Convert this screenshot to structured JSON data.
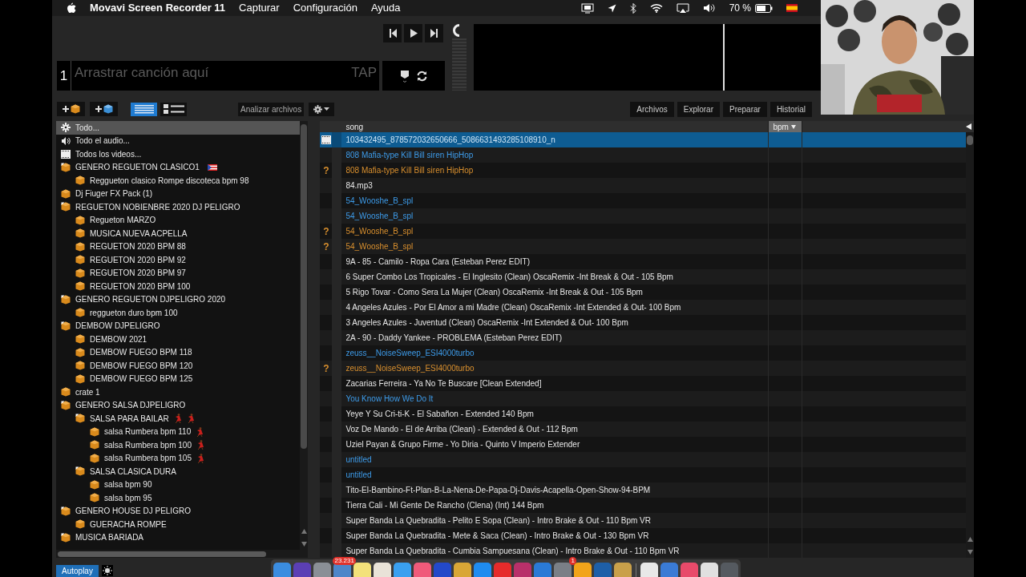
{
  "menu_bar": {
    "app_name": "Movavi Screen Recorder 11",
    "menus": [
      "Capturar",
      "Configuración",
      "Ayuda"
    ],
    "battery_text": "70 %"
  },
  "deck": {
    "number": "1",
    "placeholder": "Arrastrar canción aquí",
    "tap": "TAP"
  },
  "toolbar": {
    "analyze": "Analizar archivos",
    "views": [
      {
        "kind": "list",
        "selected": true
      },
      {
        "kind": "art",
        "selected": false
      }
    ],
    "tabs": [
      {
        "label": "Archivos",
        "selected": false
      },
      {
        "label": "Explorar",
        "selected": false
      },
      {
        "label": "Preparar",
        "selected": false
      },
      {
        "label": "Historial",
        "selected": false
      }
    ]
  },
  "sidebar": {
    "items": [
      {
        "label": "Todo...",
        "kind": "all",
        "selected": true
      },
      {
        "label": "Todo el audio...",
        "kind": "audio",
        "selected": false
      },
      {
        "label": "Todos los videos...",
        "kind": "video",
        "selected": false
      },
      {
        "label": "GENERO REGUETON CLASICO1",
        "kind": "crate",
        "selected": false,
        "expanded": true,
        "emojis": [
          {
            "kind": "flag"
          }
        ],
        "children": [
          {
            "label": "Reggueton clasico Rompe discoteca bpm 98",
            "kind": "crate",
            "selected": false
          }
        ]
      },
      {
        "label": "Dj Fiuger FX Pack (1)",
        "kind": "crate",
        "selected": false
      },
      {
        "label": "REGUETON NOBIENBRE 2020 DJ PELIGRO",
        "kind": "crate",
        "selected": false,
        "expanded": true,
        "children": [
          {
            "label": "Regueton MARZO",
            "kind": "crate",
            "selected": false
          },
          {
            "label": "MUSICA NUEVA ACPELLA",
            "kind": "crate",
            "selected": false
          },
          {
            "label": "REGUETON 2020 BPM 88",
            "kind": "crate",
            "selected": false
          },
          {
            "label": "REGUETON 2020 BPM 92",
            "kind": "crate",
            "selected": false
          },
          {
            "label": "REGUETON 2020 BPM 97",
            "kind": "crate",
            "selected": false
          },
          {
            "label": "REGUETON 2020 BPM 100",
            "kind": "crate",
            "selected": false
          }
        ]
      },
      {
        "label": "GENERO REGUETON DJPELIGRO 2020",
        "kind": "crate",
        "selected": false,
        "expanded": true,
        "children": [
          {
            "label": "reggueton duro bpm 100",
            "kind": "crate",
            "selected": false
          }
        ]
      },
      {
        "label": "DEMBOW  DJPELIGRO",
        "kind": "crate",
        "selected": false,
        "expanded": true,
        "children": [
          {
            "label": "DEMBOW 2021",
            "kind": "crate",
            "selected": false
          },
          {
            "label": "DEMBOW FUEGO BPM 118",
            "kind": "crate",
            "selected": false
          },
          {
            "label": "DEMBOW FUEGO BPM 120",
            "kind": "crate",
            "selected": false
          },
          {
            "label": "DEMBOW FUEGO BPM 125",
            "kind": "crate",
            "selected": false
          }
        ]
      },
      {
        "label": "crate 1",
        "kind": "crate",
        "selected": false
      },
      {
        "label": "GENERO SALSA DJPELIGRO",
        "kind": "crate",
        "selected": false,
        "expanded": true,
        "children": [
          {
            "label": "SALSA PARA BAILAR",
            "kind": "crate",
            "selected": false,
            "expanded": true,
            "emojis": [
              {
                "kind": "dancer"
              },
              {
                "kind": "dancer"
              }
            ],
            "children": [
              {
                "label": "salsa Rumbera bpm 110",
                "kind": "crate",
                "selected": false,
                "emojis": [
                  {
                    "kind": "dancer"
                  }
                ]
              },
              {
                "label": "salsa Rumbera bpm 100",
                "kind": "crate",
                "selected": false,
                "emojis": [
                  {
                    "kind": "dancer"
                  }
                ]
              },
              {
                "label": "salsa Rumbera bpm 105",
                "kind": "crate",
                "selected": false,
                "emojis": [
                  {
                    "kind": "dancer"
                  }
                ]
              }
            ]
          },
          {
            "label": "SALSA CLASICA DURA",
            "kind": "crate",
            "selected": false,
            "expanded": true,
            "children": [
              {
                "label": "salsa bpm  90",
                "kind": "crate",
                "selected": false
              },
              {
                "label": "salsa bpm  95",
                "kind": "crate",
                "selected": false
              }
            ]
          }
        ]
      },
      {
        "label": "GENERO HOUSE DJ PELIGRO",
        "kind": "crate",
        "selected": false,
        "expanded": true,
        "children": [
          {
            "label": "GUERACHA ROMPE",
            "kind": "crate",
            "selected": false
          }
        ]
      },
      {
        "label": "MUSICA BARIADA",
        "kind": "crate",
        "selected": false,
        "expanded": true
      }
    ]
  },
  "table": {
    "columns": [
      {
        "label": "song",
        "sorted": false
      },
      {
        "label": "bpm",
        "sorted": true
      }
    ],
    "rows": [
      {
        "song": "103432495_878572032650666_5086631493285108910_n",
        "kind": "video",
        "selected": true,
        "color": "#cfe6f7"
      },
      {
        "song": "808 Mafia-type Kill Bill siren HipHop",
        "kind": "audio",
        "selected": false,
        "color": "#3d9be9"
      },
      {
        "song": "808 Mafia-type Kill Bill siren HipHop",
        "kind": "audio",
        "selected": false,
        "color": "#d88f2e",
        "flag": "?"
      },
      {
        "song": "84.mp3",
        "kind": "audio",
        "selected": false,
        "color": "#e6e6e6"
      },
      {
        "song": "54_Wooshe_B_spl",
        "kind": "audio",
        "selected": false,
        "color": "#3d9be9"
      },
      {
        "song": "54_Wooshe_B_spl",
        "kind": "audio",
        "selected": false,
        "color": "#3d9be9"
      },
      {
        "song": "54_Wooshe_B_spl",
        "kind": "audio",
        "selected": false,
        "color": "#d88f2e",
        "flag": "?"
      },
      {
        "song": "54_Wooshe_B_spl",
        "kind": "audio",
        "selected": false,
        "color": "#d88f2e",
        "flag": "?"
      },
      {
        "song": "9A - 85 - Camilo - Ropa Cara (Esteban Perez EDIT)",
        "kind": "audio",
        "selected": false,
        "color": "#e6e6e6"
      },
      {
        "song": "6 Super Combo Los Tropicales - El Inglesito (Clean) OscaRemix -Int Break & Out - 105 Bpm",
        "kind": "audio",
        "selected": false,
        "color": "#e6e6e6"
      },
      {
        "song": "5 Rigo Tovar - Como Sera La Mujer (Clean) OscaRemix -Int Break & Out - 105 Bpm",
        "kind": "audio",
        "selected": false,
        "color": "#e6e6e6"
      },
      {
        "song": "4 Angeles Azules - Por El Amor a mi Madre (Clean) OscaRemix -Int Extended & Out- 100 Bpm",
        "kind": "audio",
        "selected": false,
        "color": "#e6e6e6"
      },
      {
        "song": "3 Angeles Azules - Juventud (Clean) OscaRemix -Int Extended & Out- 100 Bpm",
        "kind": "audio",
        "selected": false,
        "color": "#e6e6e6"
      },
      {
        "song": "2A - 90 - Daddy Yankee - PROBLEMA (Esteban Perez EDIT)",
        "kind": "audio",
        "selected": false,
        "color": "#e6e6e6"
      },
      {
        "song": "zeuss__NoiseSweep_ESI4000turbo",
        "kind": "audio",
        "selected": false,
        "color": "#3d9be9"
      },
      {
        "song": "zeuss__NoiseSweep_ESI4000turbo",
        "kind": "audio",
        "selected": false,
        "color": "#d88f2e",
        "flag": "?"
      },
      {
        "song": "Zacarias Ferreira - Ya No Te Buscare [Clean Extended]",
        "kind": "audio",
        "selected": false,
        "color": "#e6e6e6"
      },
      {
        "song": "You Know How We Do It",
        "kind": "audio",
        "selected": false,
        "color": "#3d9be9"
      },
      {
        "song": "Yeye Y Su Cri-ti-K - El Sabañon - Extended 140 Bpm",
        "kind": "audio",
        "selected": false,
        "color": "#e6e6e6"
      },
      {
        "song": "Voz De Mando - El de Arriba (Clean) - Extended & Out - 112 Bpm",
        "kind": "audio",
        "selected": false,
        "color": "#e6e6e6"
      },
      {
        "song": "Uziel Payan & Grupo Firme - Yo Diria - Quinto V Imperio Extender",
        "kind": "audio",
        "selected": false,
        "color": "#e6e6e6"
      },
      {
        "song": "untitled",
        "kind": "audio",
        "selected": false,
        "color": "#3d9be9"
      },
      {
        "song": "untitled",
        "kind": "audio",
        "selected": false,
        "color": "#3d9be9"
      },
      {
        "song": "Tito-El-Bambino-Ft-Plan-B-La-Nena-De-Papa-Dj-Davis-Acapella-Open-Show-94-BPM",
        "kind": "audio",
        "selected": false,
        "color": "#e6e6e6"
      },
      {
        "song": "Tierra Cali - Mi Gente De Rancho (Clena) (Int) 144 Bpm",
        "kind": "audio",
        "selected": false,
        "color": "#e6e6e6"
      },
      {
        "song": "Super Banda La Quebradita - Pelito E Sopa (Clean) - Intro Brake & Out - 110 Bpm VR",
        "kind": "audio",
        "selected": false,
        "color": "#e6e6e6"
      },
      {
        "song": "Super Banda La Quebradita - Mete & Saca (Clean) - Intro Brake & Out - 130 Bpm VR",
        "kind": "audio",
        "selected": false,
        "color": "#e6e6e6"
      },
      {
        "song": "Super Banda La Quebradita - Cumbia Sampuesana (Clean) - Intro Brake & Out - 110 Bpm VR",
        "kind": "audio",
        "selected": false,
        "color": "#e6e6e6"
      }
    ]
  },
  "bottom_bar": {
    "autoplay": {
      "label": "Autoplay",
      "on": true
    }
  },
  "dock": [
    {
      "kind": "app",
      "color": "#3b8de0"
    },
    {
      "kind": "app",
      "color": "#5b3fb5"
    },
    {
      "kind": "app",
      "color": "#8a8f96"
    },
    {
      "kind": "app",
      "color": "#4d86c9",
      "badge": "23.231"
    },
    {
      "kind": "app",
      "color": "#f3e17a"
    },
    {
      "kind": "app",
      "color": "#e9e3d8"
    },
    {
      "kind": "app",
      "color": "#3aa0f0"
    },
    {
      "kind": "app",
      "color": "#f05a7a"
    },
    {
      "kind": "app",
      "color": "#2349c9"
    },
    {
      "kind": "app",
      "color": "#d9a636"
    },
    {
      "kind": "app",
      "color": "#1f8cf0"
    },
    {
      "kind": "app",
      "color": "#e62b2b"
    },
    {
      "kind": "app",
      "color": "#b8306a"
    },
    {
      "kind": "app",
      "color": "#2a7ad6"
    },
    {
      "kind": "app",
      "color": "#7a7f86",
      "badge": "1"
    },
    {
      "kind": "app",
      "color": "#f2a41a"
    },
    {
      "kind": "app",
      "color": "#1e5fa8"
    },
    {
      "kind": "app",
      "color": "#c9a04a"
    },
    {
      "kind": "separator"
    },
    {
      "kind": "app",
      "color": "#e8e8e8"
    },
    {
      "kind": "app",
      "color": "#3a7bd5"
    },
    {
      "kind": "app",
      "color": "#e84a6a"
    },
    {
      "kind": "app",
      "color": "#e0e0e0"
    },
    {
      "kind": "app",
      "color": "#555a60"
    }
  ]
}
